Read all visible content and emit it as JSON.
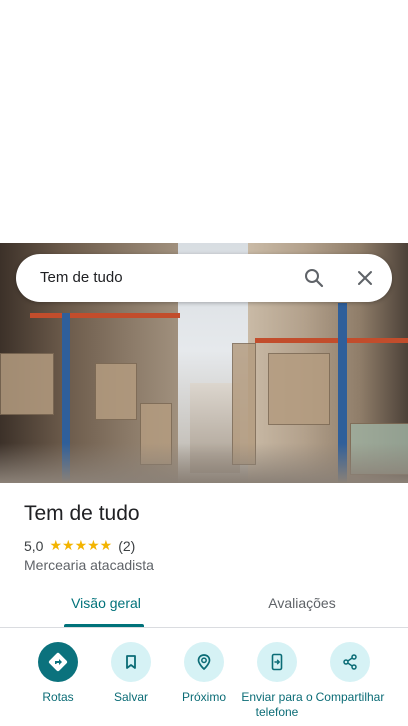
{
  "search": {
    "query": "Tem de tudo"
  },
  "place": {
    "name": "Tem de tudo",
    "rating": "5,0",
    "stars": "★★★★★",
    "review_count": "(2)",
    "category": "Mercearia atacadista"
  },
  "tabs": [
    {
      "label": "Visão geral",
      "selected": true
    },
    {
      "label": "Avaliações",
      "selected": false
    }
  ],
  "actions": [
    {
      "label": "Rotas",
      "icon": "directions-icon"
    },
    {
      "label": "Salvar",
      "icon": "bookmark-icon"
    },
    {
      "label": "Próximo",
      "icon": "nearby-icon"
    },
    {
      "label": "Enviar para o telefone",
      "icon": "send-to-phone-icon"
    },
    {
      "label": "Compartilhar",
      "icon": "share-icon"
    }
  ],
  "colors": {
    "accent": "#00727a",
    "primary_button": "#0b727d",
    "secondary_button": "#d6f2f5",
    "star": "#f3b400"
  }
}
